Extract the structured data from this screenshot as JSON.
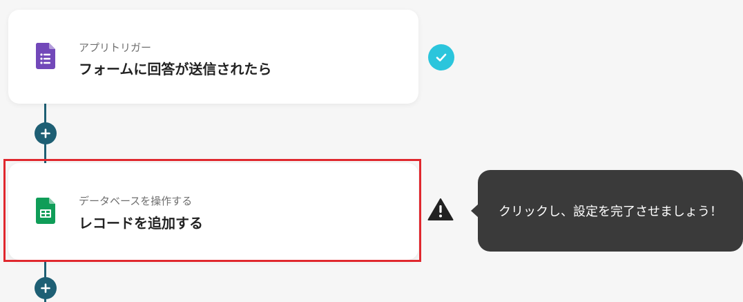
{
  "flow": {
    "steps": [
      {
        "subtitle": "アプリトリガー",
        "title": "フォームに回答が送信されたら",
        "icon": "google-forms-icon",
        "status": "complete"
      },
      {
        "subtitle": "データベースを操作する",
        "title": "レコードを追加する",
        "icon": "google-sheets-icon",
        "status": "warning"
      }
    ],
    "add_step_icon": "plus-icon"
  },
  "tooltip": {
    "text": "クリックし、設定を完了させましょう！"
  },
  "colors": {
    "connector": "#1e5f74",
    "check": "#2bc5dc",
    "highlight": "#e0282e",
    "tooltip_bg": "#3a3a3a",
    "forms_purple": "#7248b9",
    "sheets_green": "#0f9d58"
  }
}
